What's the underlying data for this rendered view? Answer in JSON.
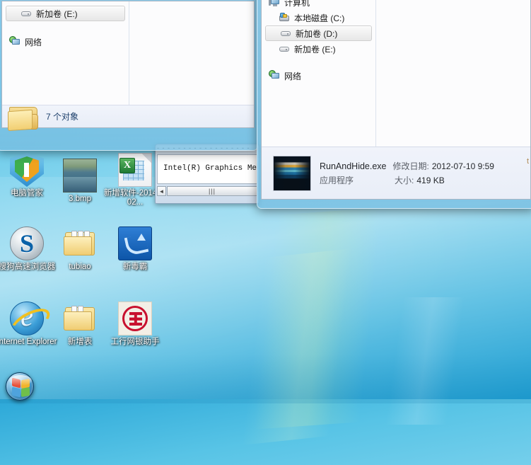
{
  "desktop": {
    "icons": [
      {
        "name": "电脑管家",
        "glyph": "shield-icon"
      },
      {
        "name": "3.bmp",
        "glyph": "photo-icon"
      },
      {
        "name": "新增软件-20140402...",
        "glyph": "excel-file-icon"
      },
      {
        "name": "搜狗高速浏览器",
        "glyph": "sogou-browser-icon"
      },
      {
        "name": "tubiao",
        "glyph": "folder-icon"
      },
      {
        "name": "新毒霸",
        "glyph": "duba-antivirus-icon"
      },
      {
        "name": "Internet Explorer",
        "glyph": "internet-explorer-icon"
      },
      {
        "name": "新增表",
        "glyph": "folder-icon"
      },
      {
        "name": "工行网银助手",
        "glyph": "icbc-assistant-icon"
      }
    ],
    "start_button_label": "开始"
  },
  "left_window": {
    "tree": [
      {
        "label": "新加卷 (E:)",
        "icon": "drive-icon",
        "selected": true,
        "indent": 1
      },
      {
        "label": "网络",
        "icon": "network-icon",
        "selected": false,
        "indent": 0
      }
    ],
    "status": {
      "text": "7 个对象",
      "icon": "folder-icon"
    }
  },
  "background_window": {
    "title_fragment": "Intel(R) Graphics Media",
    "body_text": "Intel(R) Graphics Media",
    "scroll_left_arrow": "◄",
    "scroll_thumb_grip": "|||"
  },
  "right_window": {
    "tree": [
      {
        "label": "计算机",
        "icon": "computer-icon",
        "indent": 0,
        "selected": false
      },
      {
        "label": "本地磁盘 (C:)",
        "icon": "hdd-system-icon",
        "indent": 1,
        "selected": false
      },
      {
        "label": "新加卷 (D:)",
        "icon": "drive-icon",
        "indent": 1,
        "selected": true
      },
      {
        "label": "新加卷 (E:)",
        "icon": "drive-icon",
        "indent": 1,
        "selected": false
      },
      {
        "label": "网络",
        "icon": "network-icon",
        "indent": 0,
        "selected": false
      }
    ],
    "details": {
      "file_name": "RunAndHide.exe",
      "modified_label": "修改日期:",
      "modified_value": "2012-07-10 9:59",
      "type_text": "应用程序",
      "size_label": "大小:",
      "size_value": "419 KB",
      "clipped_edge_glyph": "t"
    }
  }
}
